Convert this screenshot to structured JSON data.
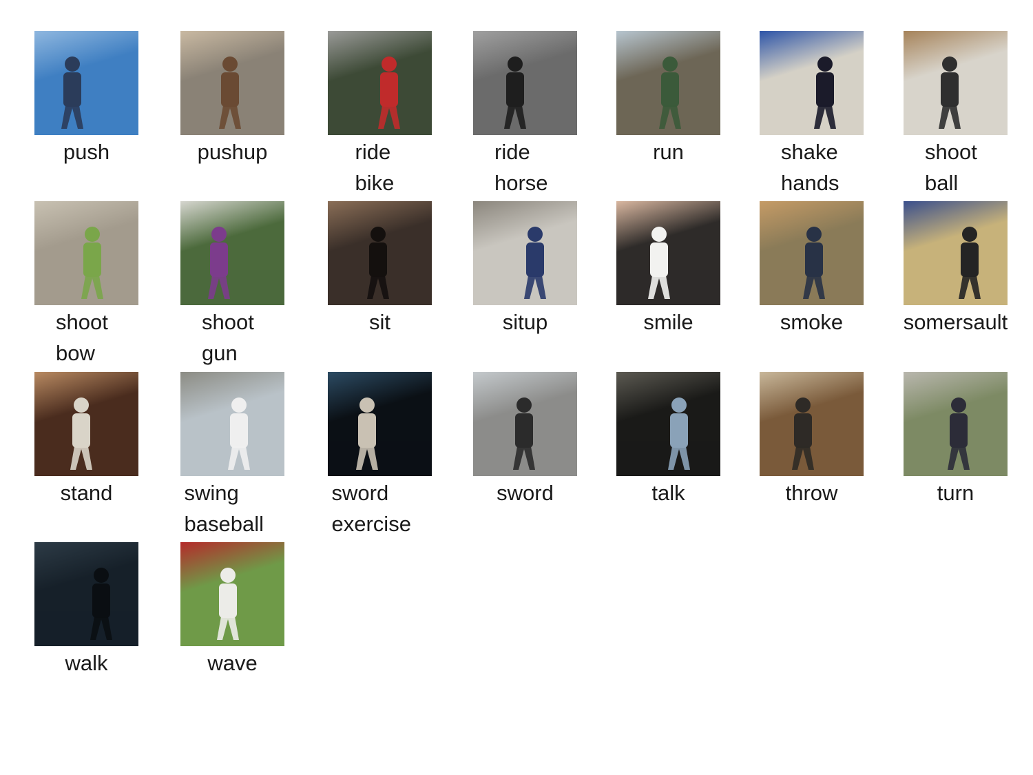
{
  "actions": [
    {
      "lines": [
        "push"
      ],
      "thumbnail": "frame-person-pushing-outdoors",
      "bg": "#3f7fc2",
      "mid": "#8fb7df",
      "fg": "#2b3c5a"
    },
    {
      "lines": [
        "pushup"
      ],
      "thumbnail": "frame-shirtless-man-doing-pushup",
      "bg": "#8a8276",
      "mid": "#c9b9a2",
      "fg": "#6a4a33"
    },
    {
      "lines": [
        "ride",
        "bike"
      ],
      "thumbnail": "frame-cyclist-on-road",
      "bg": "#3d4a36",
      "mid": "#9a9a98",
      "fg": "#c02b2b"
    },
    {
      "lines": [
        "ride",
        "horse"
      ],
      "thumbnail": "frame-horse-race-grayscale",
      "bg": "#6b6b6b",
      "mid": "#a0a0a0",
      "fg": "#1e1e1e"
    },
    {
      "lines": [
        "run"
      ],
      "thumbnail": "frame-man-running-parking-lot",
      "bg": "#6d6656",
      "mid": "#b7c5cf",
      "fg": "#3b5a3a"
    },
    {
      "lines": [
        "shake",
        "hands"
      ],
      "thumbnail": "frame-wrestlers-lineup",
      "bg": "#d5d1c6",
      "mid": "#2e55a8",
      "fg": "#1b1b2a"
    },
    {
      "lines": [
        "shoot",
        "ball"
      ],
      "thumbnail": "frame-basketball-gym",
      "bg": "#d8d4cb",
      "mid": "#a6835a",
      "fg": "#2f2f2f"
    },
    {
      "lines": [
        "shoot",
        "bow"
      ],
      "thumbnail": "frame-person-shooting-pistol-desert",
      "bg": "#a39b8d",
      "mid": "#c8c1b2",
      "fg": "#7aa64a"
    },
    {
      "lines": [
        "shoot",
        "gun"
      ],
      "thumbnail": "frame-archer-drawing-bow",
      "bg": "#4c6a3c",
      "mid": "#d6d6cf",
      "fg": "#7c3c8c"
    },
    {
      "lines": [
        "sit"
      ],
      "thumbnail": "frame-people-seated-room",
      "bg": "#3a2f29",
      "mid": "#8a6e57",
      "fg": "#14100e"
    },
    {
      "lines": [
        "situp"
      ],
      "thumbnail": "frame-man-doing-situp-garage",
      "bg": "#c9c6bf",
      "mid": "#8b867d",
      "fg": "#2a3a6a"
    },
    {
      "lines": [
        "smile"
      ],
      "thumbnail": "frame-smiling-young-man-webcam",
      "bg": "#2e2b29",
      "mid": "#d9b7a0",
      "fg": "#f2f2f0"
    },
    {
      "lines": [
        "smoke"
      ],
      "thumbnail": "frame-man-smoking-bedroom",
      "bg": "#8a7b58",
      "mid": "#c59b66",
      "fg": "#283246"
    },
    {
      "lines": [
        "somersault"
      ],
      "thumbnail": "frame-gym-trampoline",
      "bg": "#c7b27a",
      "mid": "#3a4f8c",
      "fg": "#242424"
    },
    {
      "lines": [
        "stand"
      ],
      "thumbnail": "frame-man-standing-office",
      "bg": "#4a2c1e",
      "mid": "#b88a62",
      "fg": "#d9d4c8"
    },
    {
      "lines": [
        "swing",
        "baseball"
      ],
      "thumbnail": "frame-batting-cage",
      "bg": "#b9c2c8",
      "mid": "#8c8c84",
      "fg": "#efefef"
    },
    {
      "lines": [
        "sword",
        "exercise"
      ],
      "thumbnail": "frame-sword-fighting-spotlight",
      "bg": "#0b1015",
      "mid": "#2c4b63",
      "fg": "#c9c1b3"
    },
    {
      "lines": [
        "sword"
      ],
      "thumbnail": "frame-man-with-drum-street",
      "bg": "#8c8c8a",
      "mid": "#c4c9cc",
      "fg": "#2b2b2b"
    },
    {
      "lines": [
        "talk"
      ],
      "thumbnail": "frame-dark-movie-scene",
      "bg": "#1a1a18",
      "mid": "#5c5a52",
      "fg": "#8aa2b8"
    },
    {
      "lines": [
        "throw"
      ],
      "thumbnail": "frame-person-in-house-hallway",
      "bg": "#7a5a3a",
      "mid": "#c8b79a",
      "fg": "#2e2a26"
    },
    {
      "lines": [
        "turn"
      ],
      "thumbnail": "frame-man-walking-by-fence",
      "bg": "#7d8a64",
      "mid": "#b9b7ae",
      "fg": "#2c2c38"
    },
    {
      "lines": [
        "walk"
      ],
      "thumbnail": "frame-dark-street-night",
      "bg": "#162029",
      "mid": "#2d3b46",
      "fg": "#0a0e12"
    },
    {
      "lines": [
        "wave"
      ],
      "thumbnail": "frame-crowd-at-sports-field",
      "bg": "#6f9a48",
      "mid": "#b52a2a",
      "fg": "#ecece8"
    }
  ]
}
